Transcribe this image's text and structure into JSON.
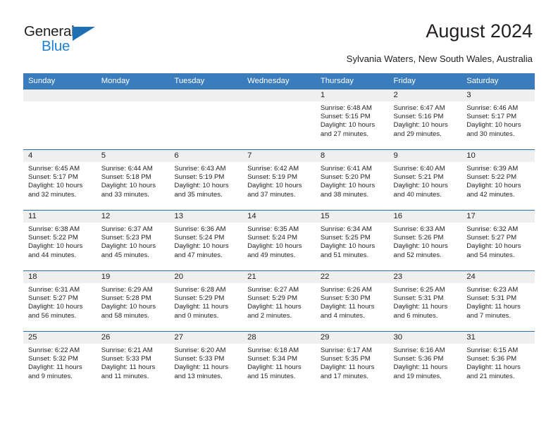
{
  "brand": {
    "name_top": "General",
    "name_bottom": "Blue",
    "triangle_color": "#1f6fb5",
    "blue_color": "#1f7fd0"
  },
  "header": {
    "title": "August 2024",
    "subtitle": "Sylvania Waters, New South Wales, Australia"
  },
  "theme": {
    "header_bg": "#3b7cbd",
    "daynum_bg": "#efefef",
    "row_border": "#2e6da4",
    "text": "#231f20"
  },
  "calendar": {
    "weekday_headers": [
      "Sunday",
      "Monday",
      "Tuesday",
      "Wednesday",
      "Thursday",
      "Friday",
      "Saturday"
    ],
    "weeks": [
      [
        {
          "empty": true
        },
        {
          "empty": true
        },
        {
          "empty": true
        },
        {
          "empty": true
        },
        {
          "day": "1",
          "sunrise": "Sunrise: 6:48 AM",
          "sunset": "Sunset: 5:15 PM",
          "daylight1": "Daylight: 10 hours",
          "daylight2": "and 27 minutes."
        },
        {
          "day": "2",
          "sunrise": "Sunrise: 6:47 AM",
          "sunset": "Sunset: 5:16 PM",
          "daylight1": "Daylight: 10 hours",
          "daylight2": "and 29 minutes."
        },
        {
          "day": "3",
          "sunrise": "Sunrise: 6:46 AM",
          "sunset": "Sunset: 5:17 PM",
          "daylight1": "Daylight: 10 hours",
          "daylight2": "and 30 minutes."
        }
      ],
      [
        {
          "day": "4",
          "sunrise": "Sunrise: 6:45 AM",
          "sunset": "Sunset: 5:17 PM",
          "daylight1": "Daylight: 10 hours",
          "daylight2": "and 32 minutes."
        },
        {
          "day": "5",
          "sunrise": "Sunrise: 6:44 AM",
          "sunset": "Sunset: 5:18 PM",
          "daylight1": "Daylight: 10 hours",
          "daylight2": "and 33 minutes."
        },
        {
          "day": "6",
          "sunrise": "Sunrise: 6:43 AM",
          "sunset": "Sunset: 5:19 PM",
          "daylight1": "Daylight: 10 hours",
          "daylight2": "and 35 minutes."
        },
        {
          "day": "7",
          "sunrise": "Sunrise: 6:42 AM",
          "sunset": "Sunset: 5:19 PM",
          "daylight1": "Daylight: 10 hours",
          "daylight2": "and 37 minutes."
        },
        {
          "day": "8",
          "sunrise": "Sunrise: 6:41 AM",
          "sunset": "Sunset: 5:20 PM",
          "daylight1": "Daylight: 10 hours",
          "daylight2": "and 38 minutes."
        },
        {
          "day": "9",
          "sunrise": "Sunrise: 6:40 AM",
          "sunset": "Sunset: 5:21 PM",
          "daylight1": "Daylight: 10 hours",
          "daylight2": "and 40 minutes."
        },
        {
          "day": "10",
          "sunrise": "Sunrise: 6:39 AM",
          "sunset": "Sunset: 5:22 PM",
          "daylight1": "Daylight: 10 hours",
          "daylight2": "and 42 minutes."
        }
      ],
      [
        {
          "day": "11",
          "sunrise": "Sunrise: 6:38 AM",
          "sunset": "Sunset: 5:22 PM",
          "daylight1": "Daylight: 10 hours",
          "daylight2": "and 44 minutes."
        },
        {
          "day": "12",
          "sunrise": "Sunrise: 6:37 AM",
          "sunset": "Sunset: 5:23 PM",
          "daylight1": "Daylight: 10 hours",
          "daylight2": "and 45 minutes."
        },
        {
          "day": "13",
          "sunrise": "Sunrise: 6:36 AM",
          "sunset": "Sunset: 5:24 PM",
          "daylight1": "Daylight: 10 hours",
          "daylight2": "and 47 minutes."
        },
        {
          "day": "14",
          "sunrise": "Sunrise: 6:35 AM",
          "sunset": "Sunset: 5:24 PM",
          "daylight1": "Daylight: 10 hours",
          "daylight2": "and 49 minutes."
        },
        {
          "day": "15",
          "sunrise": "Sunrise: 6:34 AM",
          "sunset": "Sunset: 5:25 PM",
          "daylight1": "Daylight: 10 hours",
          "daylight2": "and 51 minutes."
        },
        {
          "day": "16",
          "sunrise": "Sunrise: 6:33 AM",
          "sunset": "Sunset: 5:26 PM",
          "daylight1": "Daylight: 10 hours",
          "daylight2": "and 52 minutes."
        },
        {
          "day": "17",
          "sunrise": "Sunrise: 6:32 AM",
          "sunset": "Sunset: 5:27 PM",
          "daylight1": "Daylight: 10 hours",
          "daylight2": "and 54 minutes."
        }
      ],
      [
        {
          "day": "18",
          "sunrise": "Sunrise: 6:31 AM",
          "sunset": "Sunset: 5:27 PM",
          "daylight1": "Daylight: 10 hours",
          "daylight2": "and 56 minutes."
        },
        {
          "day": "19",
          "sunrise": "Sunrise: 6:29 AM",
          "sunset": "Sunset: 5:28 PM",
          "daylight1": "Daylight: 10 hours",
          "daylight2": "and 58 minutes."
        },
        {
          "day": "20",
          "sunrise": "Sunrise: 6:28 AM",
          "sunset": "Sunset: 5:29 PM",
          "daylight1": "Daylight: 11 hours",
          "daylight2": "and 0 minutes."
        },
        {
          "day": "21",
          "sunrise": "Sunrise: 6:27 AM",
          "sunset": "Sunset: 5:29 PM",
          "daylight1": "Daylight: 11 hours",
          "daylight2": "and 2 minutes."
        },
        {
          "day": "22",
          "sunrise": "Sunrise: 6:26 AM",
          "sunset": "Sunset: 5:30 PM",
          "daylight1": "Daylight: 11 hours",
          "daylight2": "and 4 minutes."
        },
        {
          "day": "23",
          "sunrise": "Sunrise: 6:25 AM",
          "sunset": "Sunset: 5:31 PM",
          "daylight1": "Daylight: 11 hours",
          "daylight2": "and 6 minutes."
        },
        {
          "day": "24",
          "sunrise": "Sunrise: 6:23 AM",
          "sunset": "Sunset: 5:31 PM",
          "daylight1": "Daylight: 11 hours",
          "daylight2": "and 7 minutes."
        }
      ],
      [
        {
          "day": "25",
          "sunrise": "Sunrise: 6:22 AM",
          "sunset": "Sunset: 5:32 PM",
          "daylight1": "Daylight: 11 hours",
          "daylight2": "and 9 minutes."
        },
        {
          "day": "26",
          "sunrise": "Sunrise: 6:21 AM",
          "sunset": "Sunset: 5:33 PM",
          "daylight1": "Daylight: 11 hours",
          "daylight2": "and 11 minutes."
        },
        {
          "day": "27",
          "sunrise": "Sunrise: 6:20 AM",
          "sunset": "Sunset: 5:33 PM",
          "daylight1": "Daylight: 11 hours",
          "daylight2": "and 13 minutes."
        },
        {
          "day": "28",
          "sunrise": "Sunrise: 6:18 AM",
          "sunset": "Sunset: 5:34 PM",
          "daylight1": "Daylight: 11 hours",
          "daylight2": "and 15 minutes."
        },
        {
          "day": "29",
          "sunrise": "Sunrise: 6:17 AM",
          "sunset": "Sunset: 5:35 PM",
          "daylight1": "Daylight: 11 hours",
          "daylight2": "and 17 minutes."
        },
        {
          "day": "30",
          "sunrise": "Sunrise: 6:16 AM",
          "sunset": "Sunset: 5:36 PM",
          "daylight1": "Daylight: 11 hours",
          "daylight2": "and 19 minutes."
        },
        {
          "day": "31",
          "sunrise": "Sunrise: 6:15 AM",
          "sunset": "Sunset: 5:36 PM",
          "daylight1": "Daylight: 11 hours",
          "daylight2": "and 21 minutes."
        }
      ]
    ]
  }
}
